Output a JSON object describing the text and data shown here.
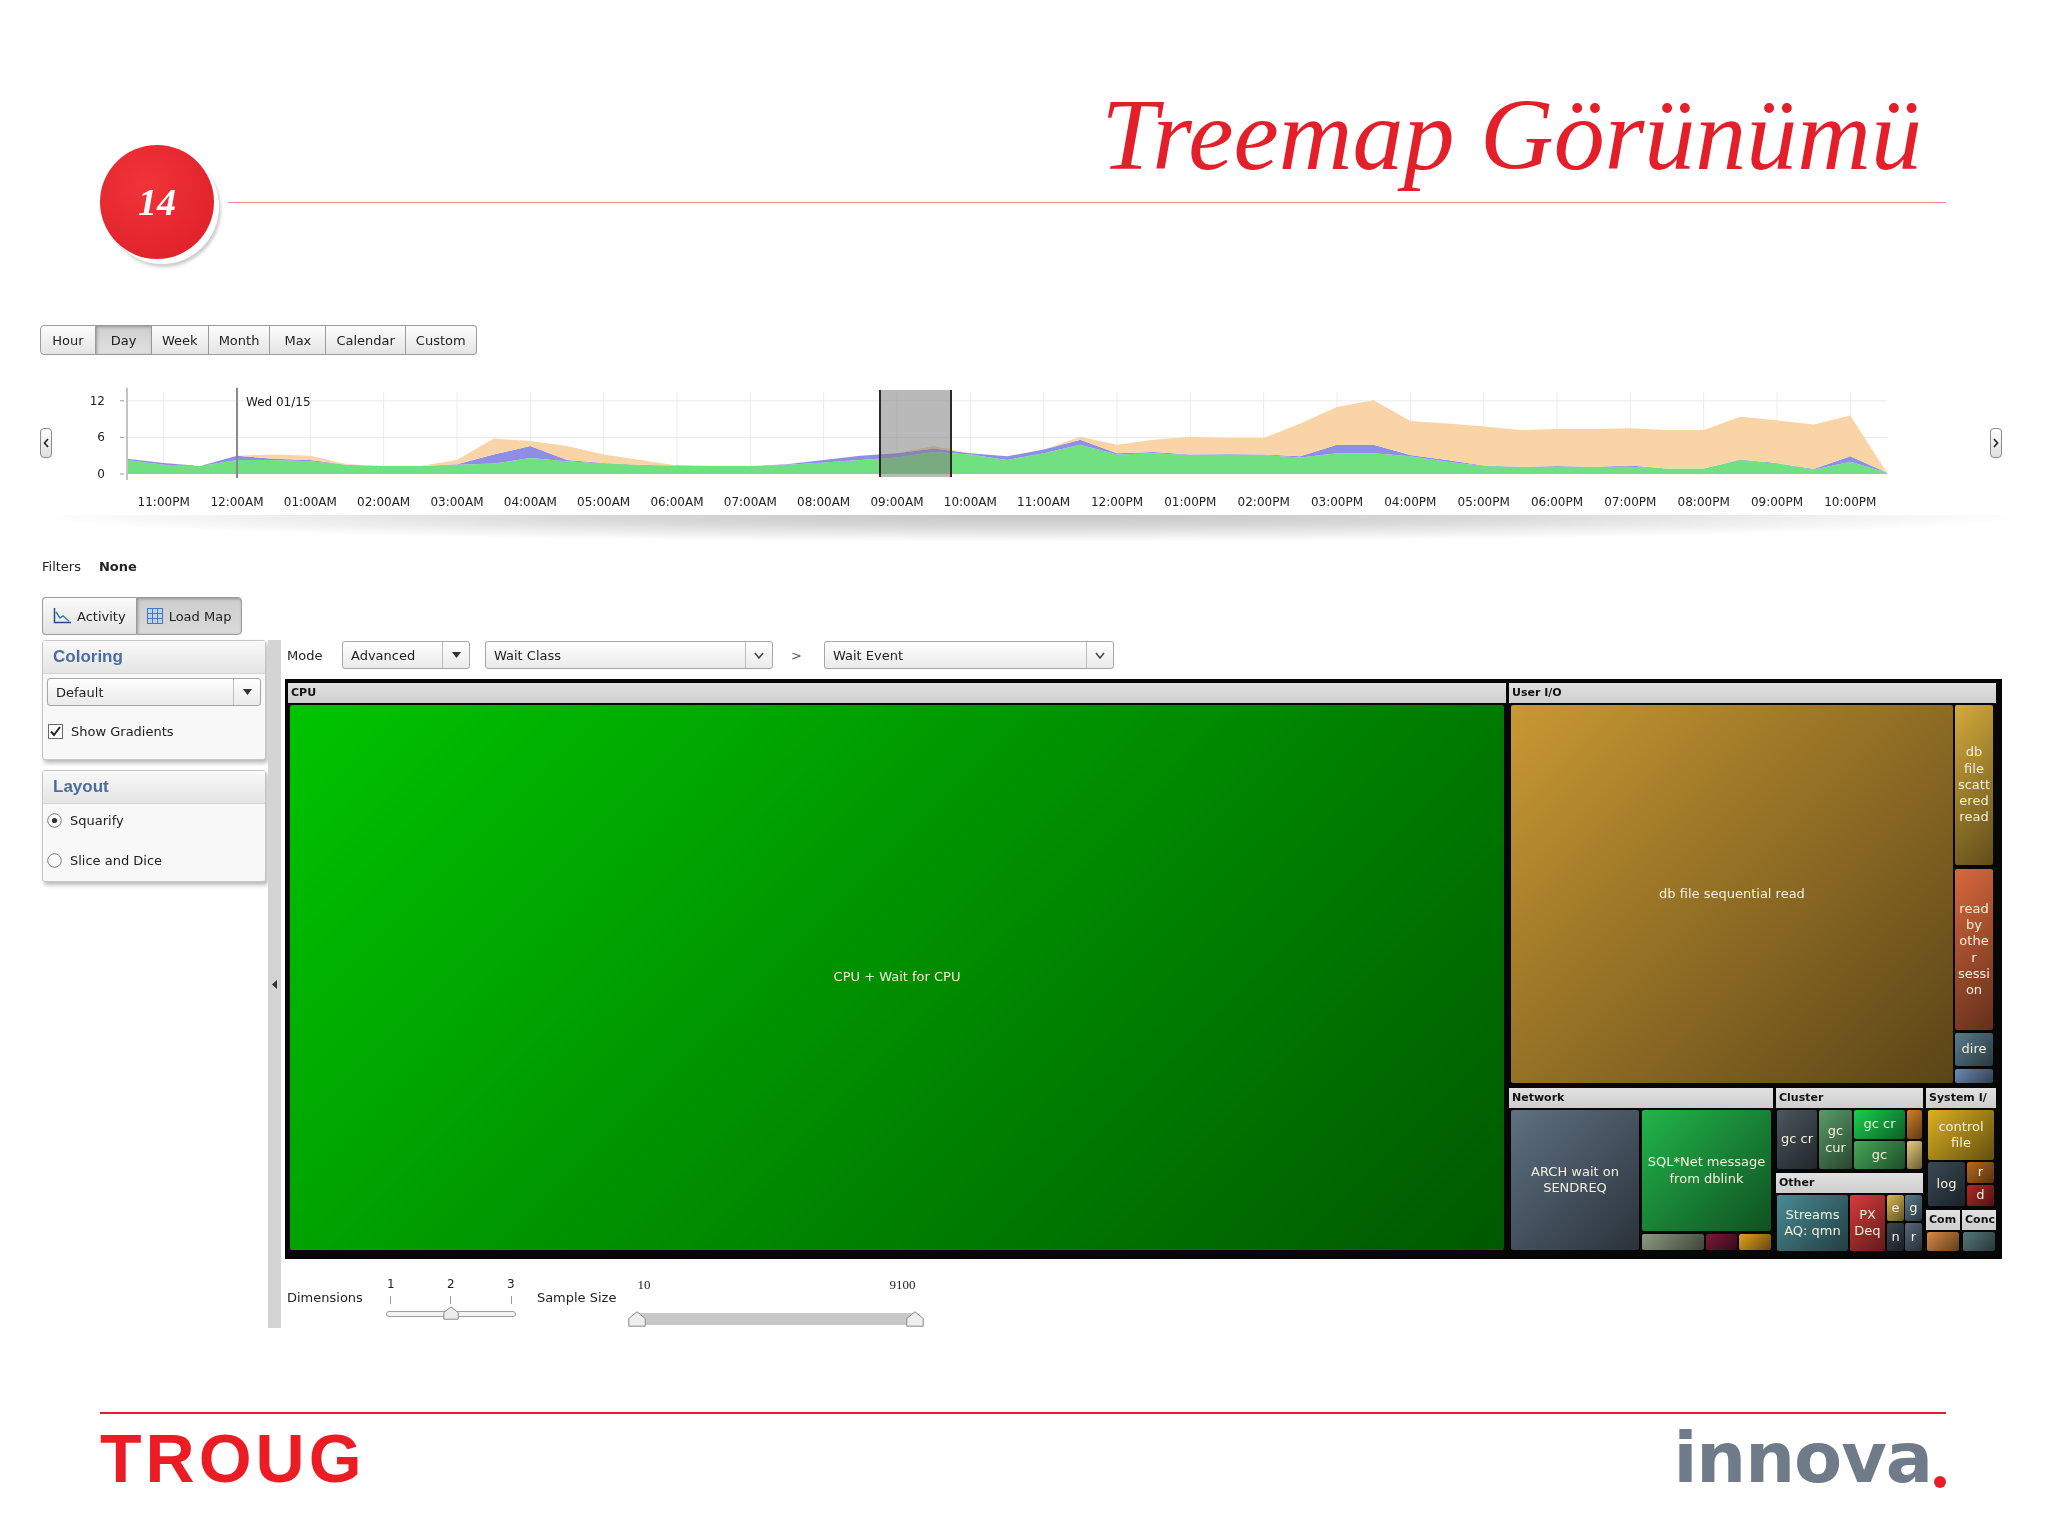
{
  "slide": {
    "number": "14",
    "title": "Treemap Görünümü"
  },
  "range_buttons": [
    {
      "label": "Hour",
      "selected": false
    },
    {
      "label": "Day",
      "selected": true
    },
    {
      "label": "Week",
      "selected": false
    },
    {
      "label": "Month",
      "selected": false
    },
    {
      "label": "Max",
      "selected": false
    },
    {
      "label": "Calendar",
      "selected": false
    },
    {
      "label": "Custom",
      "selected": false
    }
  ],
  "timeline": {
    "chart_data": {
      "type": "area",
      "stacked": true,
      "grid": true,
      "ylim": [
        0,
        13.5
      ],
      "yticks": [
        0,
        6,
        12
      ],
      "categories": [
        null,
        "11:00PM",
        null,
        "12:00AM",
        null,
        "01:00AM",
        null,
        "02:00AM",
        null,
        "03:00AM",
        null,
        "04:00AM",
        null,
        "05:00AM",
        null,
        "06:00AM",
        null,
        "07:00AM",
        null,
        "08:00AM",
        null,
        "09:00AM",
        null,
        "10:00AM",
        null,
        "11:00AM",
        null,
        "12:00PM",
        null,
        "01:00PM",
        null,
        "02:00PM",
        null,
        "03:00PM",
        null,
        "04:00PM",
        null,
        "05:00PM",
        null,
        "06:00PM",
        null,
        "07:00PM",
        null,
        "08:00PM",
        null,
        "09:00PM",
        null,
        "10:00PM",
        null
      ],
      "series": [
        {
          "color": "#70e080",
          "values": [
            2.3,
            1.5,
            1.3,
            2.3,
            2.3,
            2.1,
            1.5,
            1.3,
            1.3,
            1.5,
            1.7,
            2.6,
            2.1,
            1.7,
            1.5,
            1.3,
            1.3,
            1.3,
            1.5,
            1.9,
            2.3,
            2.7,
            3.6,
            3.2,
            2.3,
            3.4,
            4.8,
            3.2,
            3.4,
            3.1,
            3.2,
            3.1,
            2.7,
            3.4,
            3.4,
            2.9,
            2.0,
            1.3,
            1.2,
            1.2,
            1.2,
            1.2,
            0.9,
            0.9,
            2.3,
            1.8,
            0.7,
            2.0,
            0.2
          ]
        },
        {
          "color": "#8e8ee6",
          "values": [
            0.2,
            0.3,
            0,
            0.7,
            0.2,
            0.2,
            0,
            0,
            0,
            0.1,
            1.5,
            2.0,
            0.2,
            0.1,
            0,
            0.1,
            0,
            0,
            0.1,
            0.4,
            0.7,
            0.7,
            0.6,
            0.2,
            0.6,
            0.6,
            0.8,
            0.2,
            0.2,
            0.1,
            0.1,
            0.1,
            0.2,
            1.4,
            1.4,
            0.2,
            0.3,
            0.1,
            0,
            0.1,
            0,
            0.2,
            0,
            0,
            0.1,
            0,
            0.1,
            0.9,
            0
          ]
        },
        {
          "color": "#f9d4a6",
          "values": [
            0,
            0,
            0,
            0,
            0.7,
            0.7,
            0.1,
            0,
            0,
            0.7,
            2.6,
            0.8,
            2.3,
            1.4,
            0.8,
            0,
            0,
            0,
            0,
            0,
            0,
            0,
            0.4,
            0,
            0,
            0,
            0.5,
            1.4,
            2.0,
            2.9,
            2.6,
            2.7,
            5.4,
            6.2,
            7.3,
            5.6,
            6.0,
            6.4,
            6.0,
            6.1,
            6.2,
            6.1,
            6.3,
            6.3,
            7.0,
            7.0,
            7.3,
            6.7,
            0
          ]
        }
      ],
      "ref_lines": [
        {
          "axis": "x",
          "value": "12:00AM",
          "label": "Wed 01/15",
          "color": "#8a8a8a"
        }
      ]
    },
    "selection_window": {
      "edges": [
        {
          "level": 0.4271
        },
        {
          "level": 0.4688
        }
      ]
    }
  },
  "filters": {
    "label": "Filters",
    "value": "None"
  },
  "view_tabs": [
    {
      "label": "Activity",
      "kind": "activity",
      "selected": false
    },
    {
      "label": "Load Map",
      "kind": "load_map",
      "selected": true
    }
  ],
  "coloring_panel": {
    "title": "Coloring",
    "scheme": "Default",
    "show_gradients": {
      "label": "Show Gradients",
      "checked": true
    }
  },
  "layout_panel": {
    "title": "Layout",
    "options": [
      {
        "label": "Squarify",
        "selected": true
      },
      {
        "label": "Slice and Dice",
        "selected": false
      }
    ]
  },
  "mode_bar": {
    "label": "Mode",
    "mode": "Advanced",
    "group_by": "Wait Class",
    "separator": ">",
    "detail": "Wait Event"
  },
  "treemap": {
    "groups": [
      {
        "title": "CPU",
        "tiles": [
          {
            "label": "CPU + Wait for CPU",
            "color": "#00c400"
          }
        ]
      },
      {
        "title": "User I/O",
        "tiles": [
          {
            "label": "db file sequential read",
            "color": "#c89832"
          },
          {
            "label": "db file scattered read",
            "color": "#d4aa3c"
          },
          {
            "label": "read by other session",
            "color": "#d8683c"
          },
          {
            "label": "dire",
            "color": "#5a7c8c"
          },
          {
            "color": "#6a8ab0"
          }
        ]
      },
      {
        "title": "Network",
        "tiles": [
          {
            "label": "ARCH wait on SENDREQ",
            "color": "#5e7082"
          },
          {
            "label": "SQL*Net message from dblink",
            "color": "#22b44a"
          },
          {
            "color": "#8a9a80"
          },
          {
            "color": "#7a1838"
          },
          {
            "color": "#e0a020"
          }
        ]
      },
      {
        "title": "Cluster",
        "tiles": [
          {
            "label": "gc cr",
            "color": "#4a565e"
          },
          {
            "label": "gc cur",
            "color": "#5a9a68"
          },
          {
            "label": "gc cr",
            "color": "#18d050"
          },
          {
            "label": "gc",
            "color": "#44a858"
          },
          {
            "color": "#d08028"
          },
          {
            "color": "#e8cc78"
          }
        ]
      },
      {
        "title": "Other",
        "tiles": [
          {
            "label": "Streams AQ: qmn",
            "color": "#4a8a94"
          },
          {
            "label": "PX Deq",
            "color": "#d83a3a"
          },
          {
            "label": "e",
            "color": "#d8b850"
          },
          {
            "label": "g",
            "color": "#5a7a8a"
          },
          {
            "label": "n",
            "color": "#3a464e"
          },
          {
            "label": "r",
            "color": "#56687a"
          }
        ]
      },
      {
        "title": "System I/",
        "tiles": [
          {
            "label": "control file",
            "color": "#dcb020"
          },
          {
            "label": "log",
            "color": "#3a4a56"
          },
          {
            "label": "r",
            "color": "#b86a1c"
          },
          {
            "label": "d",
            "color": "#b02828"
          }
        ]
      },
      {
        "title": "Com",
        "tiles": [
          {
            "color": "#d88a40"
          }
        ]
      },
      {
        "title": "Conc",
        "tiles": [
          {
            "color": "#56787a"
          }
        ]
      }
    ]
  },
  "dimensions": {
    "label": "Dimensions",
    "ticks": [
      "1",
      "2",
      "3"
    ],
    "level": 0.5
  },
  "sample_size": {
    "label": "Sample Size",
    "min": "10",
    "max": "9100",
    "thumbs": [
      {
        "level": 0
      },
      {
        "level": 1
      }
    ]
  },
  "footer": {
    "left_logo": "TROUG",
    "right_logo": "innova"
  }
}
